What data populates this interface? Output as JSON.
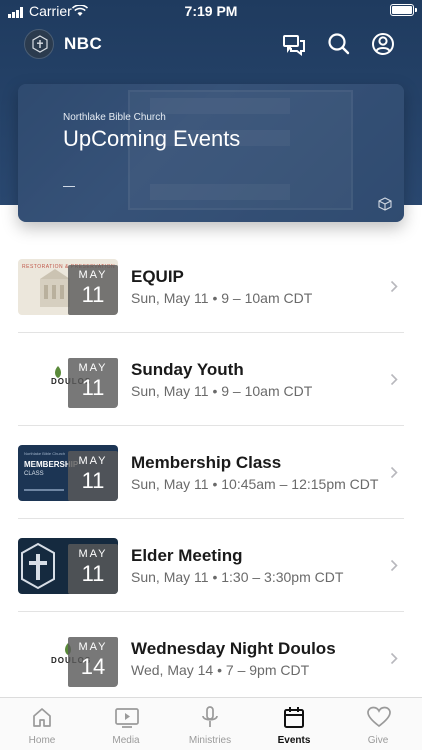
{
  "status_bar": {
    "carrier": "Carrier",
    "time": "7:19 PM"
  },
  "nav": {
    "brand": "NBC",
    "logo_icon": "church-logo-icon",
    "icons": [
      "messages-icon",
      "search-icon",
      "account-icon"
    ]
  },
  "hero": {
    "subtitle": "Northlake Bible Church",
    "title": "UpComing Events",
    "brand_color": "#1f3b5f"
  },
  "events": [
    {
      "name": "EQUIP",
      "when": "Sun, May 11 • 9 – 10am CDT",
      "month": "MAY",
      "day": "11",
      "thumb": "restoration-art"
    },
    {
      "name": "Sunday Youth",
      "when": "Sun, May 11 • 9 – 10am CDT",
      "month": "MAY",
      "day": "11",
      "thumb": "doulos-logo"
    },
    {
      "name": "Membership Class",
      "when": "Sun, May 11 • 10:45am – 12:15pm CDT",
      "month": "MAY",
      "day": "11",
      "thumb": "membership-class-art"
    },
    {
      "name": "Elder Meeting",
      "when": "Sun, May 11 • 1:30 – 3:30pm CDT",
      "month": "MAY",
      "day": "11",
      "thumb": "elder-cross-logo"
    },
    {
      "name": "Wednesday Night Doulos",
      "when": "Wed, May 14 • 7 – 9pm CDT",
      "month": "MAY",
      "day": "14",
      "thumb": "doulos-logo"
    }
  ],
  "thumb_text": {
    "equip_banner": "RESTORATION & PRESERVATION",
    "doulos_word": "DOULOS",
    "membership_small": "Northlake Bible Church",
    "membership_title": "MEMBERSHIP",
    "membership_sub": "CLASS"
  },
  "tabs": [
    {
      "label": "Home",
      "icon": "home-icon",
      "active": false
    },
    {
      "label": "Media",
      "icon": "media-icon",
      "active": false
    },
    {
      "label": "Ministries",
      "icon": "microphone-icon",
      "active": false
    },
    {
      "label": "Events",
      "icon": "calendar-icon",
      "active": true
    },
    {
      "label": "Give",
      "icon": "heart-icon",
      "active": false
    }
  ]
}
